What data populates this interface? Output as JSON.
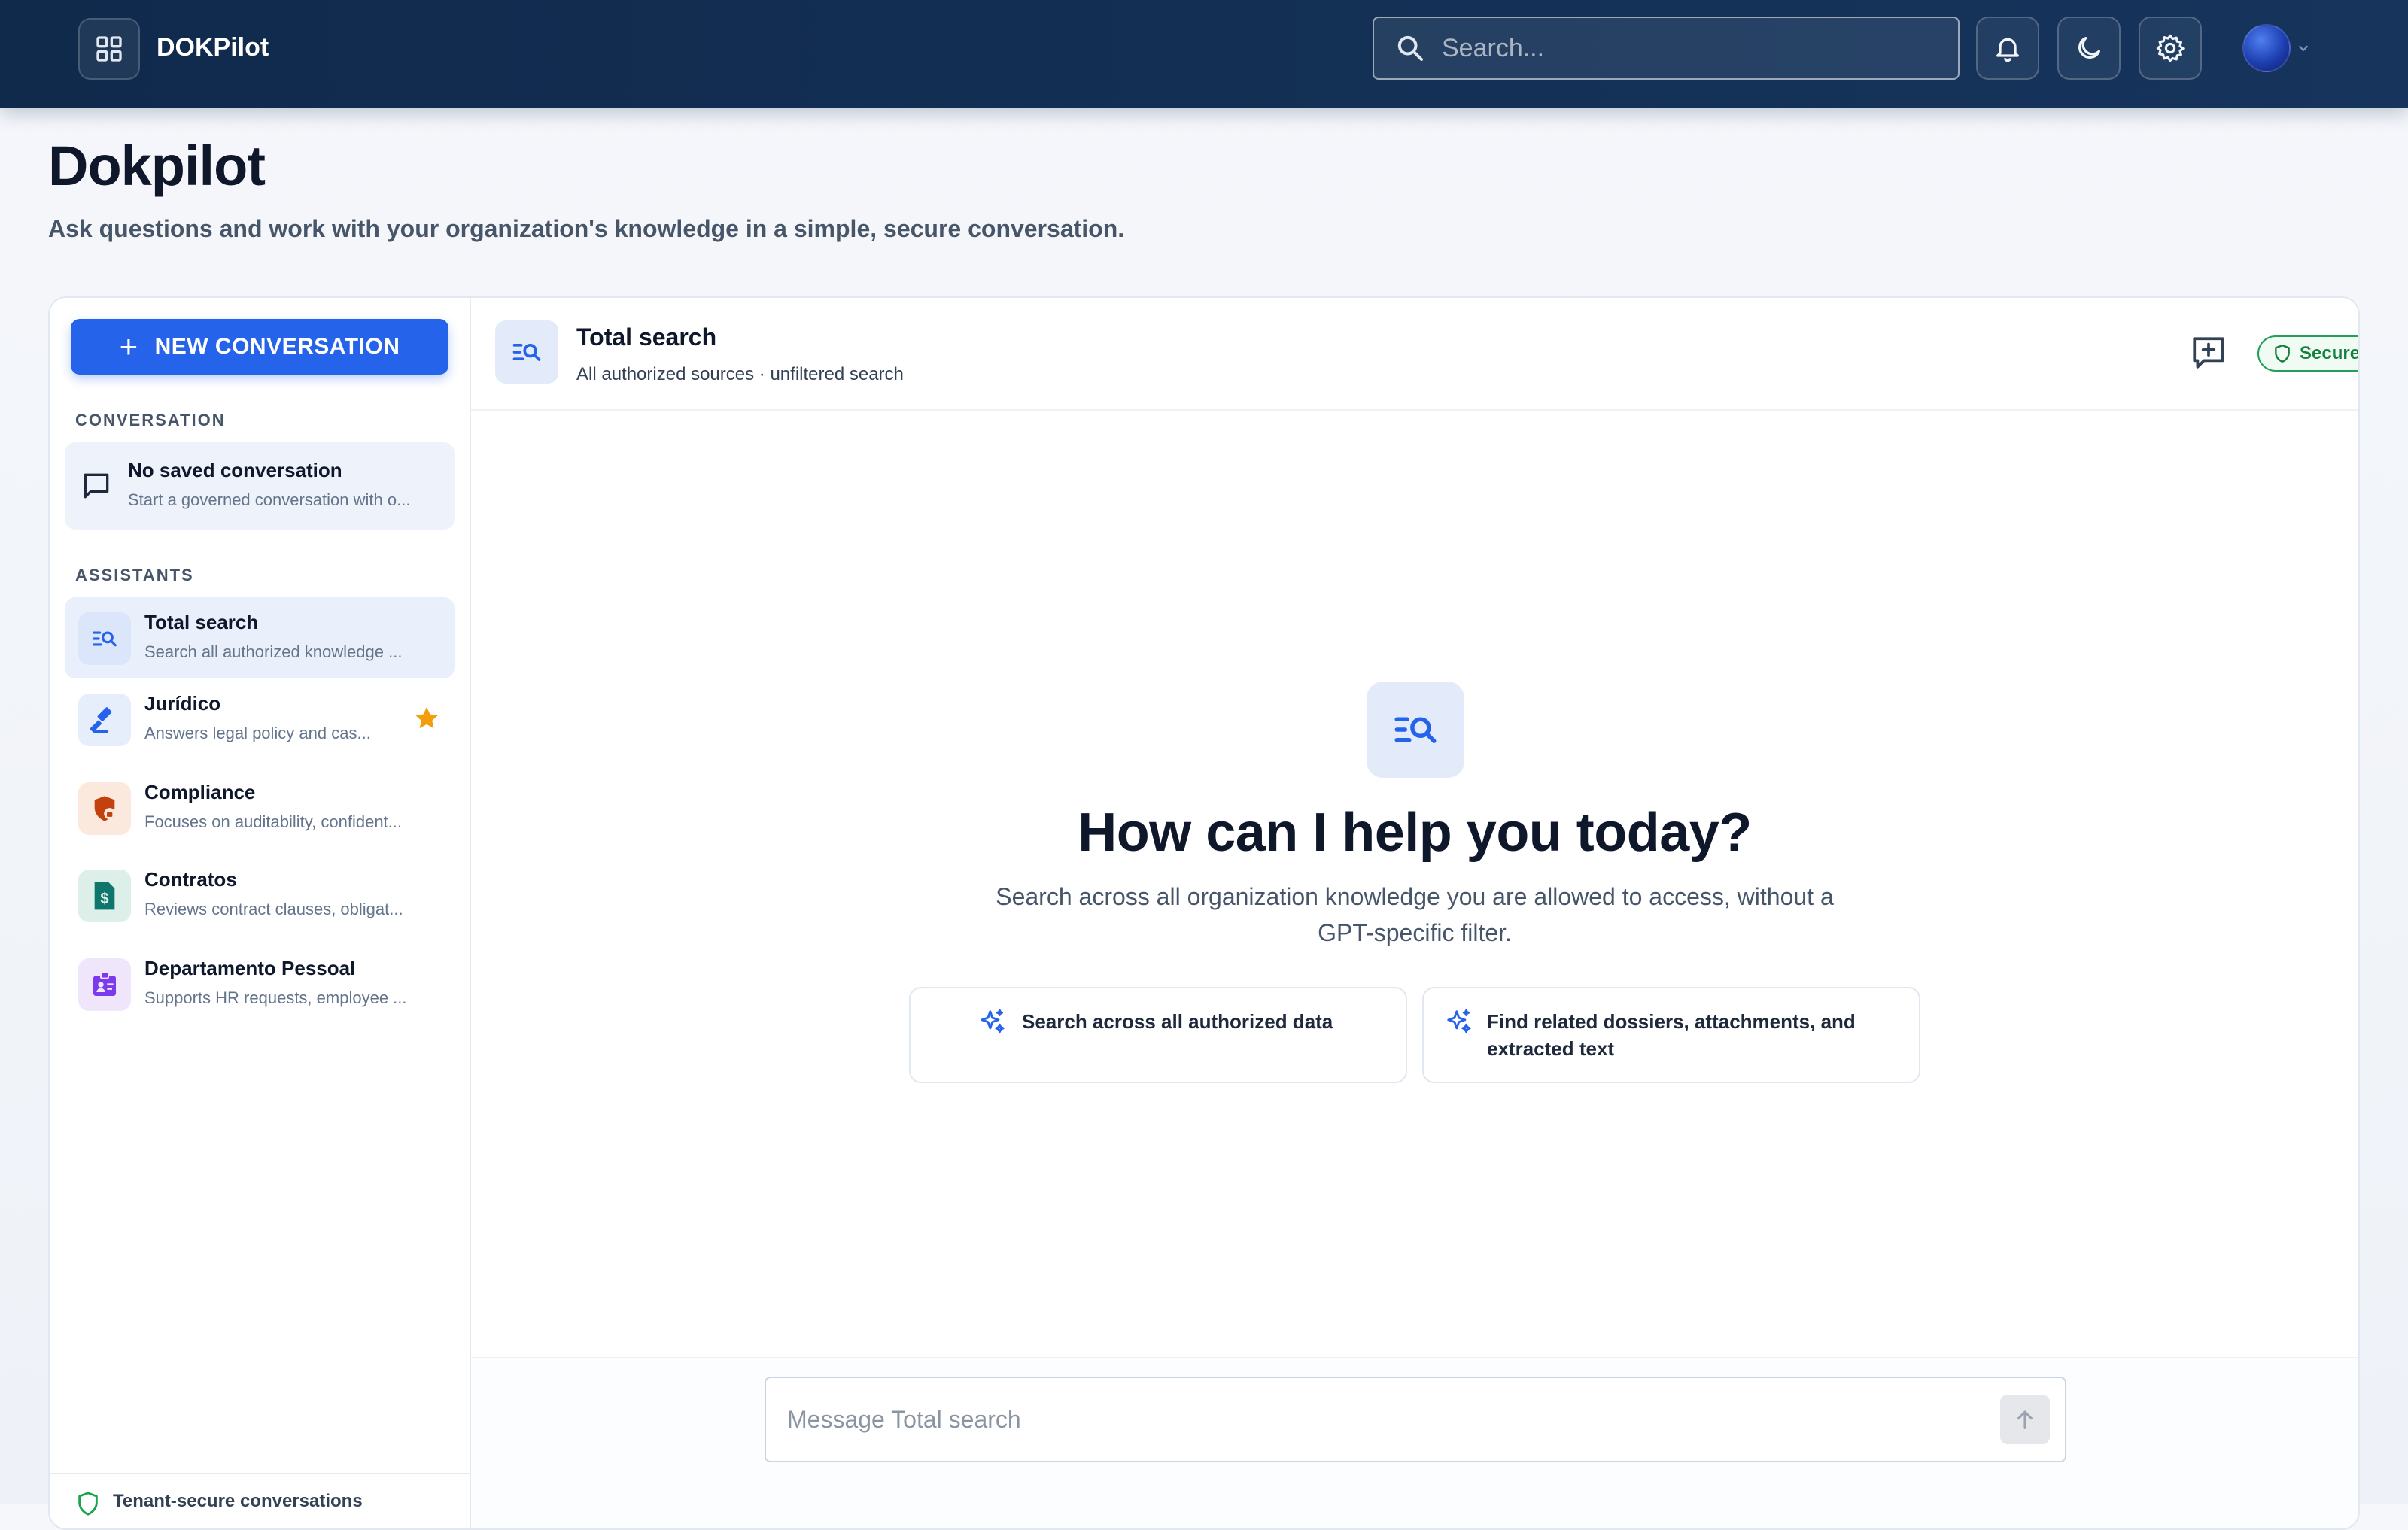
{
  "topbar": {
    "brand": "DOKPilot",
    "search_placeholder": "Search..."
  },
  "page": {
    "title": "Dokpilot",
    "subtitle": "Ask questions and work with your organization's knowledge in a simple, secure conversation."
  },
  "sidebar": {
    "new_conversation_label": "NEW CONVERSATION",
    "conversation_section": "CONVERSATION",
    "conversation_item": {
      "title": "No saved conversation",
      "desc": "Start a governed conversation with o..."
    },
    "assistants_section": "ASSISTANTS",
    "assistants": [
      {
        "title": "Total search",
        "desc": "Search all authorized knowledge ...",
        "icon": "search-list-icon",
        "color": "#2563eb"
      },
      {
        "title": "Jurídico",
        "desc": "Answers legal policy and cas...",
        "icon": "gavel-icon",
        "color": "#2563eb",
        "favorite": true
      },
      {
        "title": "Compliance",
        "desc": "Focuses on auditability, confident...",
        "icon": "shield-lock-icon",
        "color": "#c2410c"
      },
      {
        "title": "Contratos",
        "desc": "Reviews contract clauses, obligat...",
        "icon": "contract-document-icon",
        "color": "#0f766e"
      },
      {
        "title": "Departamento Pessoal",
        "desc": "Supports HR requests, employee ...",
        "icon": "id-badge-icon",
        "color": "#7c3aed"
      }
    ],
    "footer_text": "Tenant-secure conversations"
  },
  "chat": {
    "header_title": "Total search",
    "header_subtitle": "All authorized sources · unfiltered search",
    "secure_label": "Secure",
    "welcome_title": "How can I help you today?",
    "welcome_subtitle": "Search across all organization knowledge you are allowed to access, without a GPT-specific filter.",
    "suggestions": [
      "Search across all authorized data",
      "Find related dossiers, attachments, and extracted text"
    ],
    "composer_placeholder": "Message Total search"
  },
  "colors": {
    "accent": "#2563eb",
    "topbar": "#102a4c",
    "secure": "#15803d",
    "star": "#f59e0b"
  }
}
